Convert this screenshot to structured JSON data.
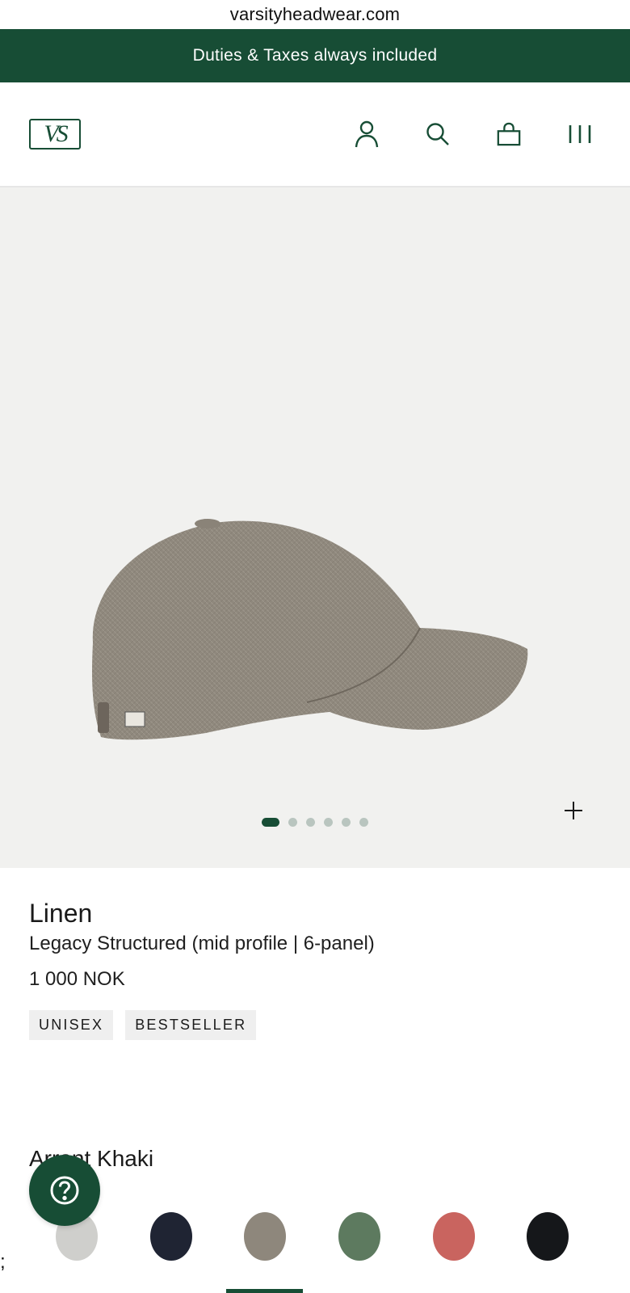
{
  "browser": {
    "url": "varsityheadwear.com"
  },
  "promo": {
    "text": "Duties & Taxes always included"
  },
  "header": {
    "logo_text": "VS",
    "icons": [
      "account-icon",
      "search-icon",
      "bag-icon",
      "menu-icon"
    ]
  },
  "gallery": {
    "slide_count": 6,
    "active_slide": 1
  },
  "product": {
    "name": "Linen",
    "model": "Legacy Structured (mid profile | 6-panel)",
    "price": "1 000 NOK",
    "badges": [
      "UNISEX",
      "BESTSELLER"
    ],
    "selected_color": "Arrant Khaki"
  },
  "swatches": [
    {
      "name": "light-grey",
      "color": "#cfcfcc"
    },
    {
      "name": "navy",
      "color": "#1f2433"
    },
    {
      "name": "khaki",
      "color": "#8e877c"
    },
    {
      "name": "green",
      "color": "#5d7a5f"
    },
    {
      "name": "red",
      "color": "#c9645f"
    },
    {
      "name": "black",
      "color": "#15171a"
    }
  ],
  "misc": {
    "stray_char": ";"
  },
  "colors": {
    "brand_green": "#174d35",
    "gallery_bg": "#f1f1ef"
  }
}
